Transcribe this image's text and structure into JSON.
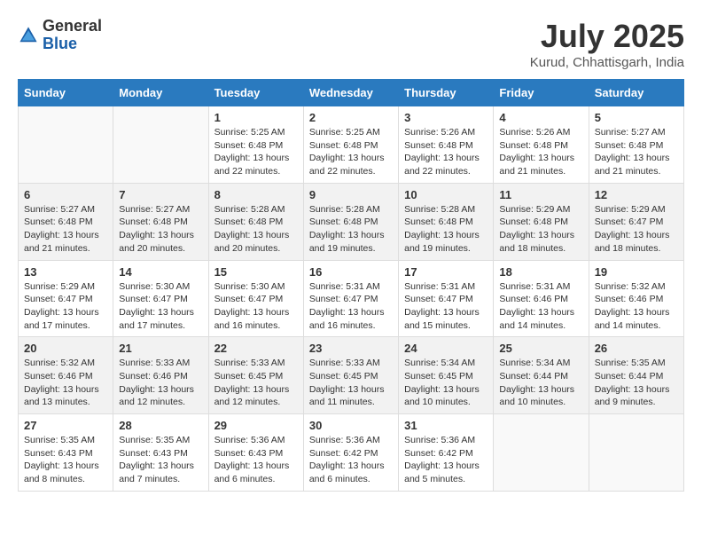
{
  "logo": {
    "general": "General",
    "blue": "Blue"
  },
  "title": "July 2025",
  "location": "Kurud, Chhattisgarh, India",
  "headers": [
    "Sunday",
    "Monday",
    "Tuesday",
    "Wednesday",
    "Thursday",
    "Friday",
    "Saturday"
  ],
  "weeks": [
    [
      {
        "day": "",
        "info": ""
      },
      {
        "day": "",
        "info": ""
      },
      {
        "day": "1",
        "info": "Sunrise: 5:25 AM\nSunset: 6:48 PM\nDaylight: 13 hours and 22 minutes."
      },
      {
        "day": "2",
        "info": "Sunrise: 5:25 AM\nSunset: 6:48 PM\nDaylight: 13 hours and 22 minutes."
      },
      {
        "day": "3",
        "info": "Sunrise: 5:26 AM\nSunset: 6:48 PM\nDaylight: 13 hours and 22 minutes."
      },
      {
        "day": "4",
        "info": "Sunrise: 5:26 AM\nSunset: 6:48 PM\nDaylight: 13 hours and 21 minutes."
      },
      {
        "day": "5",
        "info": "Sunrise: 5:27 AM\nSunset: 6:48 PM\nDaylight: 13 hours and 21 minutes."
      }
    ],
    [
      {
        "day": "6",
        "info": "Sunrise: 5:27 AM\nSunset: 6:48 PM\nDaylight: 13 hours and 21 minutes."
      },
      {
        "day": "7",
        "info": "Sunrise: 5:27 AM\nSunset: 6:48 PM\nDaylight: 13 hours and 20 minutes."
      },
      {
        "day": "8",
        "info": "Sunrise: 5:28 AM\nSunset: 6:48 PM\nDaylight: 13 hours and 20 minutes."
      },
      {
        "day": "9",
        "info": "Sunrise: 5:28 AM\nSunset: 6:48 PM\nDaylight: 13 hours and 19 minutes."
      },
      {
        "day": "10",
        "info": "Sunrise: 5:28 AM\nSunset: 6:48 PM\nDaylight: 13 hours and 19 minutes."
      },
      {
        "day": "11",
        "info": "Sunrise: 5:29 AM\nSunset: 6:48 PM\nDaylight: 13 hours and 18 minutes."
      },
      {
        "day": "12",
        "info": "Sunrise: 5:29 AM\nSunset: 6:47 PM\nDaylight: 13 hours and 18 minutes."
      }
    ],
    [
      {
        "day": "13",
        "info": "Sunrise: 5:29 AM\nSunset: 6:47 PM\nDaylight: 13 hours and 17 minutes."
      },
      {
        "day": "14",
        "info": "Sunrise: 5:30 AM\nSunset: 6:47 PM\nDaylight: 13 hours and 17 minutes."
      },
      {
        "day": "15",
        "info": "Sunrise: 5:30 AM\nSunset: 6:47 PM\nDaylight: 13 hours and 16 minutes."
      },
      {
        "day": "16",
        "info": "Sunrise: 5:31 AM\nSunset: 6:47 PM\nDaylight: 13 hours and 16 minutes."
      },
      {
        "day": "17",
        "info": "Sunrise: 5:31 AM\nSunset: 6:47 PM\nDaylight: 13 hours and 15 minutes."
      },
      {
        "day": "18",
        "info": "Sunrise: 5:31 AM\nSunset: 6:46 PM\nDaylight: 13 hours and 14 minutes."
      },
      {
        "day": "19",
        "info": "Sunrise: 5:32 AM\nSunset: 6:46 PM\nDaylight: 13 hours and 14 minutes."
      }
    ],
    [
      {
        "day": "20",
        "info": "Sunrise: 5:32 AM\nSunset: 6:46 PM\nDaylight: 13 hours and 13 minutes."
      },
      {
        "day": "21",
        "info": "Sunrise: 5:33 AM\nSunset: 6:46 PM\nDaylight: 13 hours and 12 minutes."
      },
      {
        "day": "22",
        "info": "Sunrise: 5:33 AM\nSunset: 6:45 PM\nDaylight: 13 hours and 12 minutes."
      },
      {
        "day": "23",
        "info": "Sunrise: 5:33 AM\nSunset: 6:45 PM\nDaylight: 13 hours and 11 minutes."
      },
      {
        "day": "24",
        "info": "Sunrise: 5:34 AM\nSunset: 6:45 PM\nDaylight: 13 hours and 10 minutes."
      },
      {
        "day": "25",
        "info": "Sunrise: 5:34 AM\nSunset: 6:44 PM\nDaylight: 13 hours and 10 minutes."
      },
      {
        "day": "26",
        "info": "Sunrise: 5:35 AM\nSunset: 6:44 PM\nDaylight: 13 hours and 9 minutes."
      }
    ],
    [
      {
        "day": "27",
        "info": "Sunrise: 5:35 AM\nSunset: 6:43 PM\nDaylight: 13 hours and 8 minutes."
      },
      {
        "day": "28",
        "info": "Sunrise: 5:35 AM\nSunset: 6:43 PM\nDaylight: 13 hours and 7 minutes."
      },
      {
        "day": "29",
        "info": "Sunrise: 5:36 AM\nSunset: 6:43 PM\nDaylight: 13 hours and 6 minutes."
      },
      {
        "day": "30",
        "info": "Sunrise: 5:36 AM\nSunset: 6:42 PM\nDaylight: 13 hours and 6 minutes."
      },
      {
        "day": "31",
        "info": "Sunrise: 5:36 AM\nSunset: 6:42 PM\nDaylight: 13 hours and 5 minutes."
      },
      {
        "day": "",
        "info": ""
      },
      {
        "day": "",
        "info": ""
      }
    ]
  ]
}
